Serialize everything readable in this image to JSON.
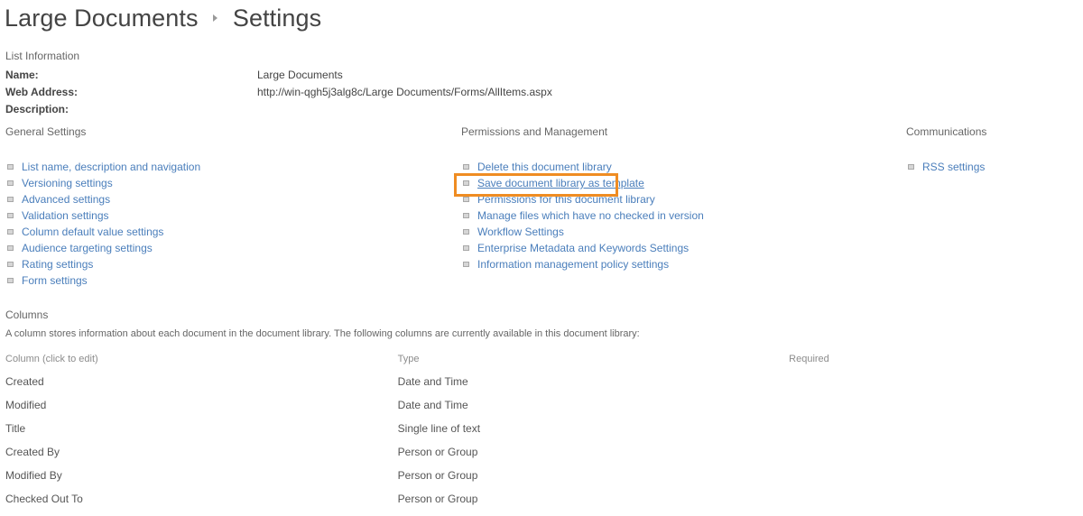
{
  "header": {
    "breadcrumb_root": "Large Documents",
    "separator_icon": "chevron-right-icon",
    "breadcrumb_current": "Settings"
  },
  "list_information": {
    "section_title": "List Information",
    "rows": [
      {
        "label": "Name:",
        "value": "Large Documents"
      },
      {
        "label": "Web Address:",
        "value": "http://win-qgh5j3alg8c/Large Documents/Forms/AllItems.aspx"
      },
      {
        "label": "Description:",
        "value": ""
      }
    ]
  },
  "settings_columns": {
    "general": {
      "heading": "General Settings",
      "links": [
        "List name, description and navigation",
        "Versioning settings",
        "Advanced settings",
        "Validation settings",
        "Column default value settings",
        "Audience targeting settings",
        "Rating settings",
        "Form settings"
      ]
    },
    "permissions": {
      "heading": "Permissions and Management",
      "links": [
        "Delete this document library",
        "Save document library as template",
        "Permissions for this document library",
        "Manage files which have no checked in version",
        "Workflow Settings",
        "Enterprise Metadata and Keywords Settings",
        "Information management policy settings"
      ],
      "highlighted_link": "Save document library as template"
    },
    "communications": {
      "heading": "Communications",
      "links": [
        "RSS settings"
      ]
    }
  },
  "columns_section": {
    "heading": "Columns",
    "description": "A column stores information about each document in the document library. The following columns are currently available in this document library:",
    "table_headers": [
      "Column (click to edit)",
      "Type",
      "Required"
    ],
    "rows": [
      {
        "name": "Created",
        "type": "Date and Time",
        "required": ""
      },
      {
        "name": "Modified",
        "type": "Date and Time",
        "required": ""
      },
      {
        "name": "Title",
        "type": "Single line of text",
        "required": ""
      },
      {
        "name": "Created By",
        "type": "Person or Group",
        "required": ""
      },
      {
        "name": "Modified By",
        "type": "Person or Group",
        "required": ""
      },
      {
        "name": "Checked Out To",
        "type": "Person or Group",
        "required": ""
      }
    ]
  },
  "theme": {
    "link_color": "#4a7ebb",
    "text_color": "#444444",
    "muted_color": "#666666",
    "highlight_color": "#ef8c22",
    "background": "#ffffff"
  }
}
